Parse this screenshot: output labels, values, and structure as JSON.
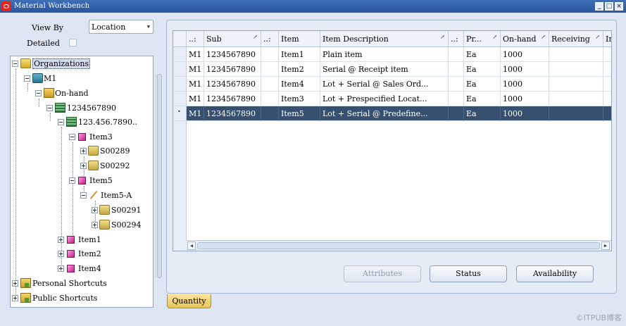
{
  "window": {
    "title": "Material Workbench"
  },
  "filters": {
    "view_by_label": "View By",
    "view_by_value": "Location",
    "detailed_label": "Detailed"
  },
  "tree": {
    "organizations": "Organizations",
    "org": "M1",
    "onhand": "On-hand",
    "subinventory": "1234567890",
    "locator": "123.456.7890..",
    "item3": "Item3",
    "lot1": "S00289",
    "lot2": "S00292",
    "item5": "Item5",
    "item5_serial": "Item5-A",
    "lot3": "S00291",
    "lot4": "S00294",
    "item1": "Item1",
    "item2": "Item2",
    "item4": "Item4",
    "personal_shortcuts": "Personal Shortcuts",
    "public_shortcuts": "Public Shortcuts"
  },
  "grid": {
    "columns": [
      "..:",
      "Sub",
      "..:",
      "Item",
      "Item Description",
      "..:",
      "Pr...",
      "On-hand",
      "Receiving",
      "In"
    ],
    "rows": [
      {
        "org": "M1",
        "sub": "1234567890",
        "item": "Item1",
        "desc": "Plain item",
        "uom": "Ea",
        "onhand": "1000"
      },
      {
        "org": "M1",
        "sub": "1234567890",
        "item": "Item2",
        "desc": "Serial @ Receipt item",
        "uom": "Ea",
        "onhand": "1000"
      },
      {
        "org": "M1",
        "sub": "1234567890",
        "item": "Item4",
        "desc": "Lot + Serial @ Sales Ord...",
        "uom": "Ea",
        "onhand": "1000"
      },
      {
        "org": "M1",
        "sub": "1234567890",
        "item": "Item3",
        "desc": "Lot + Prespecified Locat...",
        "uom": "Ea",
        "onhand": "1000"
      },
      {
        "org": "M1",
        "sub": "1234567890",
        "item": "Item5",
        "desc": "Lot + Serial @ Predefine...",
        "uom": "Ea",
        "onhand": "1000"
      }
    ],
    "selected_row": 4
  },
  "buttons": {
    "attributes": "Attributes",
    "status": "Status",
    "availability": "Availability"
  },
  "tabs": {
    "quantity": "Quantity"
  },
  "watermark": "©ITPUB博客"
}
